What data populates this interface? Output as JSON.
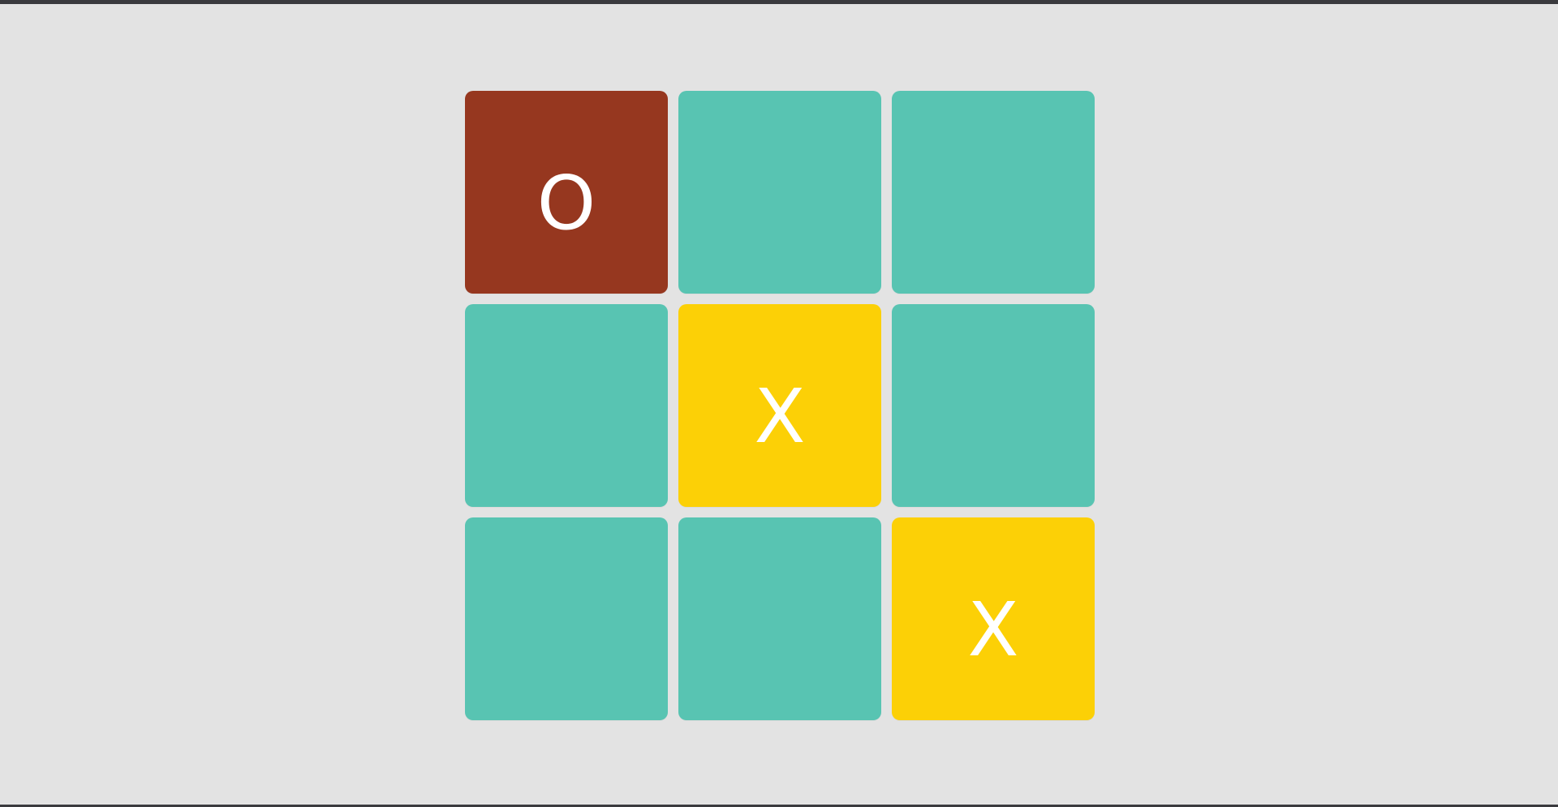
{
  "board": {
    "cells": [
      {
        "mark": "O",
        "state": "o"
      },
      {
        "mark": "",
        "state": "empty"
      },
      {
        "mark": "",
        "state": "empty"
      },
      {
        "mark": "",
        "state": "empty"
      },
      {
        "mark": "X",
        "state": "x"
      },
      {
        "mark": "",
        "state": "empty"
      },
      {
        "mark": "",
        "state": "empty"
      },
      {
        "mark": "",
        "state": "empty"
      },
      {
        "mark": "X",
        "state": "x"
      }
    ]
  },
  "colors": {
    "page_background": "#e3e3e3",
    "frame": "#3a3a3e",
    "empty_cell": "#58c4b2",
    "o_cell": "#96371f",
    "x_cell": "#fcd006",
    "mark_text": "#ffffff"
  }
}
